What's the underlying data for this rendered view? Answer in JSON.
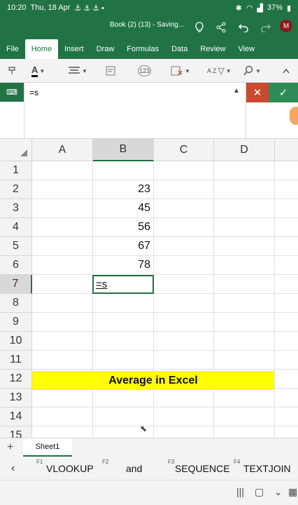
{
  "status": {
    "time": "10:20",
    "date": "Thu, 18 Apr",
    "left_icons": "⚓ ⚓ ⚓ •",
    "battery": "37%"
  },
  "title": {
    "doc": "Book (2) (13) - Saving...",
    "avatar": "M"
  },
  "tabs": [
    "File",
    "Home",
    "Insert",
    "Draw",
    "Formulas",
    "Data",
    "Review",
    "View"
  ],
  "toolbar": {
    "num_format": "123",
    "sort": "A Z"
  },
  "formula_bar": {
    "fx": "⌨",
    "text": "=s"
  },
  "grid": {
    "columns": [
      "A",
      "B",
      "C",
      "D"
    ],
    "rows": [
      "1",
      "2",
      "3",
      "4",
      "5",
      "6",
      "7",
      "8",
      "9",
      "10",
      "11",
      "12",
      "13",
      "14",
      "15"
    ],
    "values": [
      "23",
      "45",
      "56",
      "67",
      "78"
    ],
    "active_input": "=s",
    "banner": "Average in Excel"
  },
  "sheet": {
    "tab": "Sheet1"
  },
  "suggestions": [
    {
      "key": "F1",
      "name": "VLOOKUP"
    },
    {
      "key": "F2",
      "name": "and"
    },
    {
      "key": "F3",
      "name": "SEQUENCE"
    },
    {
      "key": "F4",
      "name": "TEXTJOIN"
    }
  ],
  "colors": {
    "excel_green": "#217346",
    "banner_yellow": "#ffff00",
    "cancel_red": "#c94a2f",
    "enter_green": "#2e8b57"
  }
}
